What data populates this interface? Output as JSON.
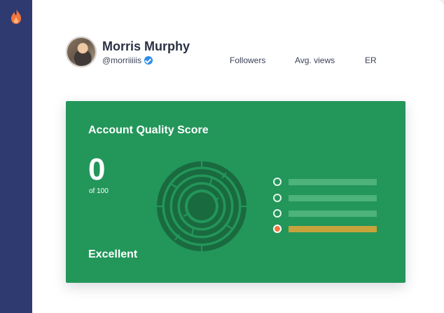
{
  "app": {
    "logo_icon": "flame-icon",
    "sidebar_color": "#2f3b70"
  },
  "profile": {
    "name": "Morris Murphy",
    "handle": "@morriiiiis",
    "verified_icon": "verified-badge-icon"
  },
  "stats": {
    "followers_label": "Followers",
    "views_label": "Avg. views",
    "er_label": "ER"
  },
  "quality": {
    "title": "Account Quality Score",
    "score": "0",
    "score_suffix": "of 100",
    "grade": "Excellent",
    "card_color": "#23965a",
    "metrics": [
      {
        "status": "ok"
      },
      {
        "status": "ok"
      },
      {
        "status": "ok"
      },
      {
        "status": "alert",
        "color": "#f4763d"
      }
    ]
  }
}
